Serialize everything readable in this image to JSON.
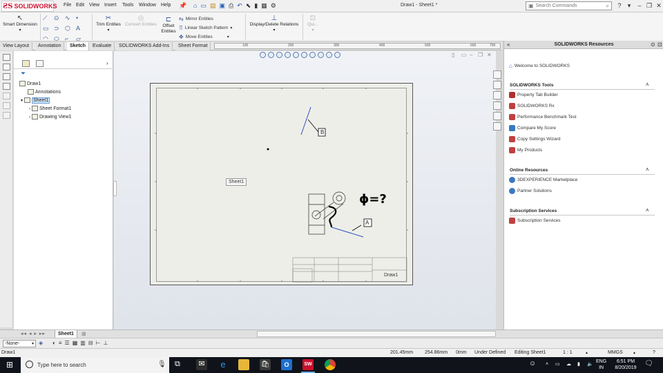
{
  "app": {
    "logo": "SOLIDWORKS",
    "document_title": "Draw1 - Sheet1 *"
  },
  "menu": [
    "File",
    "Edit",
    "View",
    "Insert",
    "Tools",
    "Window",
    "Help"
  ],
  "search": {
    "placeholder": "Search Commands"
  },
  "commands": {
    "smart_dimension": "Smart Dimension",
    "trim_entities": "Trim Entities",
    "convert_entities": "Convert Entities",
    "offset_entities_1": "Offset",
    "offset_entities_2": "Entities",
    "mirror_entities": "Mirror Entities",
    "linear_sketch_pattern": "Linear Sketch Pattern",
    "move_entities": "Move Entities",
    "display_delete_relations": "Display/Delete Relations",
    "quick_snaps": "Qui..."
  },
  "tabs": [
    "View Layout",
    "Annotation",
    "Sketch",
    "Evaluate",
    "SOLIDWORKS Add-Ins",
    "Sheet Format"
  ],
  "active_tab": "Sketch",
  "ruler_ticks": [
    "100",
    "200",
    "300",
    "400",
    "500",
    "600",
    "700"
  ],
  "tree": {
    "root": "Draw1",
    "items": [
      {
        "label": "Annotations"
      },
      {
        "label": "Sheet1",
        "selected": true
      },
      {
        "label": "Sheet Format1"
      },
      {
        "label": "Drawing View1"
      }
    ]
  },
  "sheet": {
    "tooltip": "Sheet1",
    "callout_b": "B",
    "callout_a": "A",
    "handwriting": "ϕ=?",
    "title_block_name": "Draw1"
  },
  "resources": {
    "title": "SOLIDWORKS Resources",
    "welcome": "Welcome to SOLIDWORKS",
    "tools_section": "SOLIDWORKS Tools",
    "tools": [
      "Property Tab Builder",
      "SOLIDWORKS Rx",
      "Performance Benchmark Test",
      "Compare My Score",
      "Copy Settings Wizard",
      "My Products"
    ],
    "online_section": "Online Resources",
    "online": [
      "3DEXPERIENCE Marketplace",
      "Partner Solutions"
    ],
    "subscription_section": "Subscription Services",
    "subscription": [
      "Subscription Services"
    ]
  },
  "sheet_tab": "Sheet1",
  "layer": "-None-",
  "status": {
    "doc": "Draw1",
    "x": "201.45mm",
    "y": "254.86mm",
    "z": "0mm",
    "state": "Under Defined",
    "mode": "Editing Sheet1",
    "scale": "1 : 1",
    "units": "MMGS"
  },
  "taskbar": {
    "search_placeholder": "Type here to search",
    "lang_1": "ENG",
    "lang_2": "IN",
    "time": "6:51 PM",
    "date": "8/20/2019"
  }
}
